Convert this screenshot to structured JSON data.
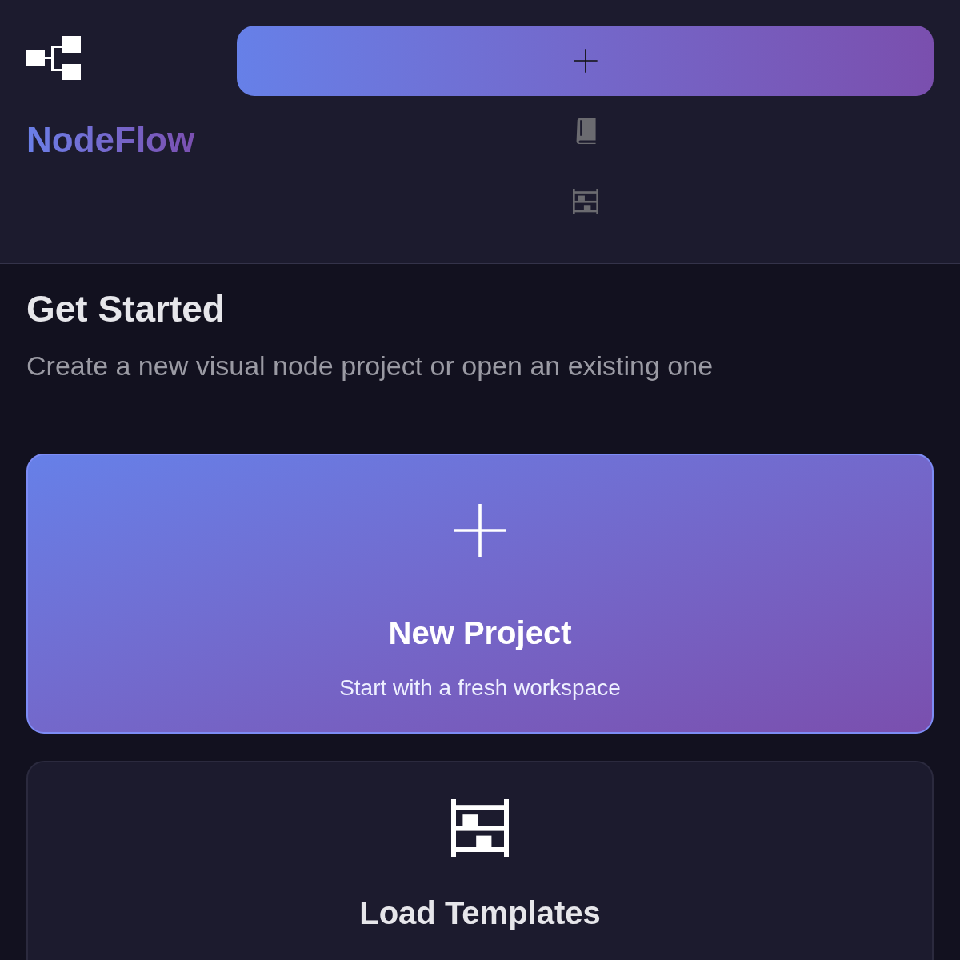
{
  "brand": {
    "name": "NodeFlow"
  },
  "nav": [
    {
      "kind": "new",
      "selected": true
    },
    {
      "kind": "docs",
      "selected": false
    },
    {
      "kind": "templates",
      "selected": false
    }
  ],
  "intro": {
    "title": "Get Started",
    "subtitle": "Create a new visual node project or open an existing one"
  },
  "cards": [
    {
      "kind": "new",
      "selected": true,
      "title": "New Project",
      "subtitle": "Start with a fresh workspace"
    },
    {
      "kind": "templates",
      "selected": false,
      "title": "Load Templates"
    }
  ]
}
